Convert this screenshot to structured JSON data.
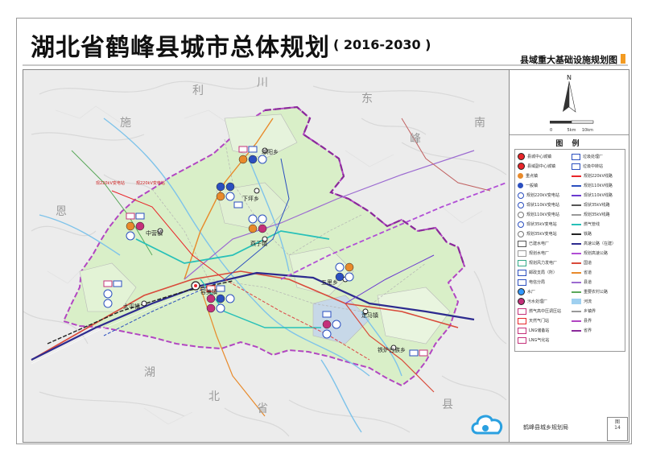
{
  "header": {
    "title": "湖北省鹤峰县城市总体规划",
    "years": "( 2016-2030 )",
    "subtitle": "县域重大基础设施规划图"
  },
  "legend": {
    "title": "图 例",
    "items_left": [
      "县城中心城镇",
      "县域副中心城镇",
      "重点镇",
      "一般镇",
      "规划220kV变电站",
      "现状110kV变电站",
      "规划110kV变电站",
      "现状35kV变电站",
      "规划35kV变电站",
      "已建水电厂",
      "规划水电厂",
      "规划风力发电厂",
      "邮政支局（所）",
      "电信分局",
      "水厂",
      "污水处理厂",
      "燃气高中压调压站",
      "天然气门站",
      "LNG储备站",
      "LNG气化站"
    ],
    "items_right": [
      "垃圾处理厂",
      "垃圾中转站",
      "规划220kV线路",
      "规划110kV线路",
      "现状110kV线路",
      "现状35kV线路",
      "规划35kV线路",
      "燃气管线",
      "铁路",
      "高速公路（在建）",
      "规划高速公路",
      "国道",
      "省道",
      "县道",
      "重要农村公路",
      "河流",
      "乡镇界",
      "县界",
      "省界"
    ],
    "colors": {
      "town_center": "#e8262a",
      "substation": "#2b4fbf",
      "water": "#3399ff",
      "sewage": "#c4307a",
      "gas_line": "#27c0b8",
      "railway": "#222222",
      "highway": "#2d2b8f",
      "national_road": "#d94a3a",
      "provincial_road": "#e88a2b",
      "county_road": "#9c6bd1",
      "river": "#9fd0f0",
      "county_border": "#b246c2",
      "province_border": "#8a2a9a"
    }
  },
  "north": {
    "label": "N",
    "scale_left": "0",
    "scale_mid": "5km",
    "scale_right": "10km"
  },
  "map_labels": {
    "towns": [
      "容美镇",
      "太平镇",
      "中营镇",
      "燕子镇",
      "下坪乡",
      "邬阳乡",
      "走马镇",
      "铁炉白族乡",
      "五里乡",
      "容美镇"
    ],
    "regions": [
      "湖",
      "北",
      "省",
      "恩",
      "施",
      "利",
      "川",
      "东",
      "南",
      "县",
      "峰"
    ],
    "notes": [
      "现220kV变电站",
      "规220kV变电站"
    ]
  },
  "footer": {
    "logo_text": "鹤峰县城乡规划局",
    "corner_label": "图",
    "corner_number": "14"
  }
}
